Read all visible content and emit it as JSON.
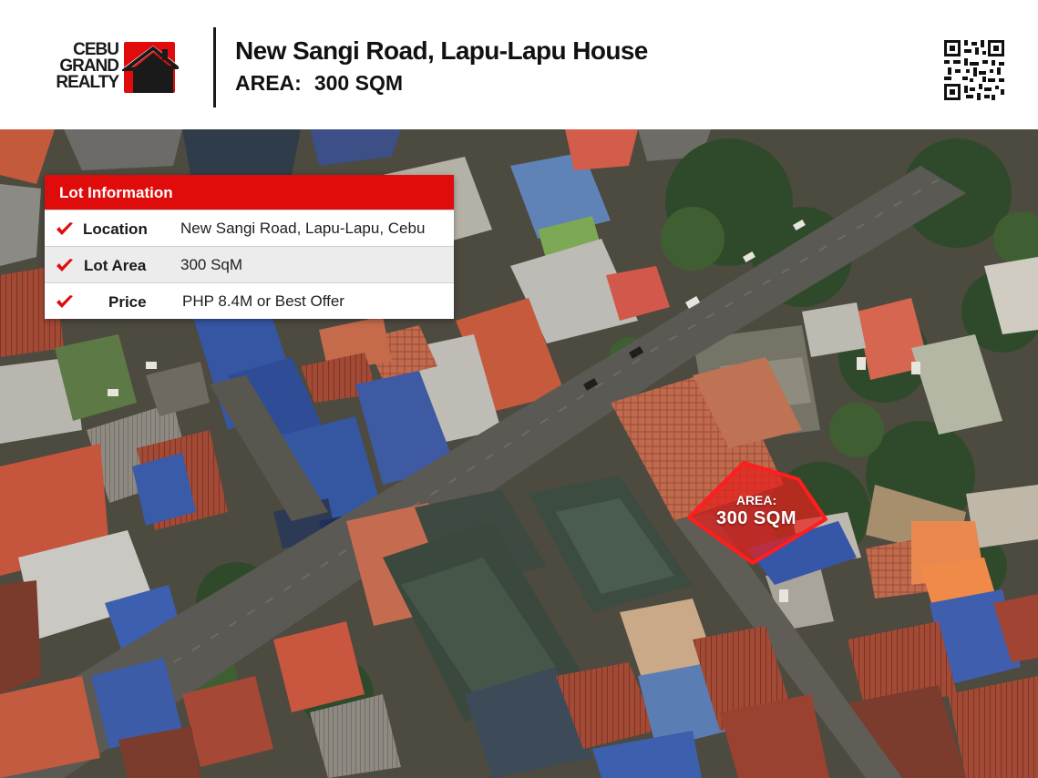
{
  "logo": {
    "lines": [
      "CEBU",
      "GRAND",
      "REALTY"
    ],
    "accent": "#e00c0c",
    "icon": "house-logo-icon"
  },
  "header": {
    "title": "New Sangi Road, Lapu-Lapu House",
    "area_label": "AREA:",
    "area_value": "300 SQM",
    "qr_icon": "qr-code-icon"
  },
  "lot_info": {
    "heading": "Lot Information",
    "check_icon": "checkmark-icon",
    "rows": [
      {
        "label": "Location",
        "value": "New Sangi Road, Lapu-Lapu, Cebu"
      },
      {
        "label": "Lot Area",
        "value": "300 SqM"
      },
      {
        "label": "Price",
        "value": "PHP 8.4M or Best Offer"
      }
    ]
  },
  "callout": {
    "label": "AREA:",
    "value": "300 SQM",
    "color": "#e8201c"
  },
  "colors": {
    "brand_red": "#e00c0c",
    "text_dark": "#111111"
  }
}
